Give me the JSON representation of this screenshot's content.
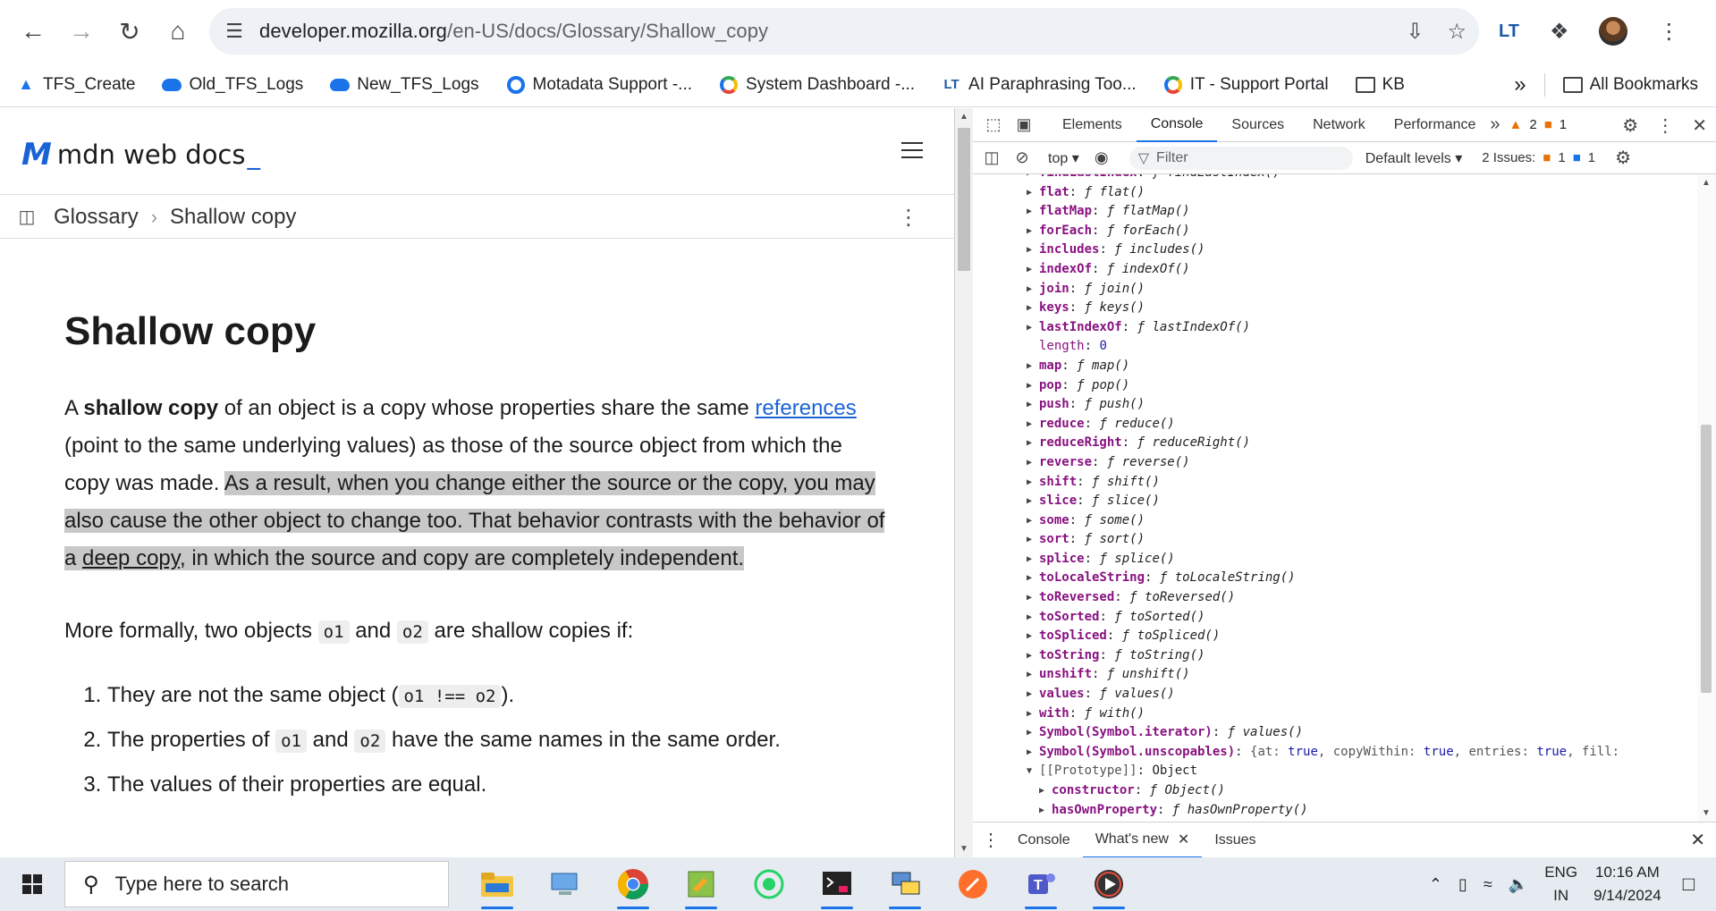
{
  "browser": {
    "url_host": "developer.mozilla.org",
    "url_path": "/en-US/docs/Glossary/Shallow_copy",
    "profile_initials": "LT"
  },
  "bookmarks": {
    "items": [
      {
        "label": "TFS_Create",
        "icon": "tfs-icon"
      },
      {
        "label": "Old_TFS_Logs",
        "icon": "cloud-icon"
      },
      {
        "label": "New_TFS_Logs",
        "icon": "cloud-icon"
      },
      {
        "label": "Motadata Support -...",
        "icon": "motadata-icon"
      },
      {
        "label": "System Dashboard -...",
        "icon": "dashboard-icon"
      },
      {
        "label": "AI Paraphrasing Too...",
        "icon": "paraphrase-icon"
      },
      {
        "label": "IT - Support Portal",
        "icon": "support-icon"
      },
      {
        "label": "KB",
        "icon": "folder-icon"
      }
    ],
    "more": "»",
    "all_bookmarks": "All Bookmarks"
  },
  "mdn": {
    "logo_mark": "M",
    "logo_text": "mdn web docs",
    "logo_cursor": "_",
    "breadcrumb": [
      "Glossary",
      "Shallow copy"
    ],
    "title": "Shallow copy",
    "p1": {
      "a": "A ",
      "bold": "shallow copy",
      "b": " of an object is a copy whose properties share the same ",
      "link": "references",
      "c": " (point to the same underlying values) as those of the source object from which the copy was made. ",
      "hl1": "As a result, when you change either the source or the copy, you may also cause the other object to change too. That behavior contrasts with the behavior of a ",
      "hl_link": "deep copy",
      "hl2": ", in which the source and copy are completely independent."
    },
    "p2": {
      "a": "More formally, two objects ",
      "code1": "o1",
      "b": " and ",
      "code2": "o2",
      "c": " are shallow copies if:"
    },
    "list": [
      {
        "a": "They are not the same object (",
        "code": "o1 !== o2",
        "b": ")."
      },
      {
        "a": "The properties of ",
        "code": "o1",
        "b": " and ",
        "code2": "o2",
        "c": " have the same names in the same order."
      },
      {
        "a": "The values of their properties are equal."
      }
    ]
  },
  "devtools": {
    "tabs": [
      "Elements",
      "Console",
      "Sources",
      "Network",
      "Performance"
    ],
    "active_tab": "Console",
    "more_tabs": "»",
    "warnings": "2",
    "errors": "1",
    "context": "top",
    "filter_placeholder": "Filter",
    "levels": "Default levels",
    "issues_label": "2 Issues:",
    "issues_errors": "1",
    "issues_info": "1",
    "drawer_tabs": [
      "Console",
      "What's new",
      "Issues"
    ],
    "drawer_active": "What's new"
  },
  "console_rows": [
    {
      "key": "findLastIndex",
      "val": "findLastIndex()",
      "cut": true
    },
    {
      "key": "flat",
      "val": "flat()"
    },
    {
      "key": "flatMap",
      "val": "flatMap()"
    },
    {
      "key": "forEach",
      "val": "forEach()"
    },
    {
      "key": "includes",
      "val": "includes()"
    },
    {
      "key": "indexOf",
      "val": "indexOf()"
    },
    {
      "key": "join",
      "val": "join()"
    },
    {
      "key": "keys",
      "val": "keys()"
    },
    {
      "key": "lastIndexOf",
      "val": "lastIndexOf()"
    },
    {
      "key": "length",
      "val": "0",
      "type": "number"
    },
    {
      "key": "map",
      "val": "map()"
    },
    {
      "key": "pop",
      "val": "pop()"
    },
    {
      "key": "push",
      "val": "push()"
    },
    {
      "key": "reduce",
      "val": "reduce()"
    },
    {
      "key": "reduceRight",
      "val": "reduceRight()"
    },
    {
      "key": "reverse",
      "val": "reverse()"
    },
    {
      "key": "shift",
      "val": "shift()"
    },
    {
      "key": "slice",
      "val": "slice()"
    },
    {
      "key": "some",
      "val": "some()"
    },
    {
      "key": "sort",
      "val": "sort()"
    },
    {
      "key": "splice",
      "val": "splice()"
    },
    {
      "key": "toLocaleString",
      "val": "toLocaleString()"
    },
    {
      "key": "toReversed",
      "val": "toReversed()"
    },
    {
      "key": "toSorted",
      "val": "toSorted()"
    },
    {
      "key": "toSpliced",
      "val": "toSpliced()"
    },
    {
      "key": "toString",
      "val": "toString()"
    },
    {
      "key": "unshift",
      "val": "unshift()"
    },
    {
      "key": "values",
      "val": "values()"
    },
    {
      "key": "with",
      "val": "with()"
    },
    {
      "key": "Symbol(Symbol.iterator)",
      "val": "values()"
    },
    {
      "key": "Symbol(Symbol.unscopables)",
      "val": "{at: true, copyWithin: true, entries: true, fill:",
      "type": "object"
    },
    {
      "key": "[[Prototype]]",
      "val": "Object",
      "type": "proto",
      "expanded": true
    },
    {
      "key": "constructor",
      "val": "Object()",
      "indent": true
    },
    {
      "key": "hasOwnProperty",
      "val": "hasOwnProperty()",
      "indent": true
    }
  ],
  "taskbar": {
    "search_placeholder": "Type here to search",
    "apps": [
      "file-explorer-icon",
      "network-icon",
      "chrome-icon",
      "notepad-icon",
      "whatsapp-icon",
      "terminal-icon",
      "remote-desktop-icon",
      "pen-icon",
      "teams-icon",
      "media-player-icon"
    ],
    "lang_top": "ENG",
    "lang_bottom": "IN",
    "time": "10:16 AM",
    "date": "9/14/2024"
  }
}
